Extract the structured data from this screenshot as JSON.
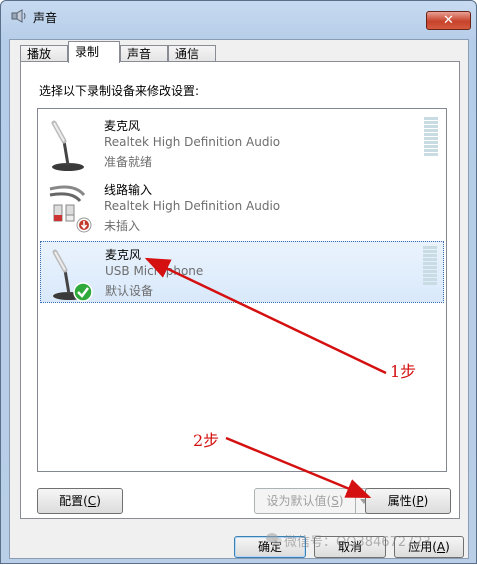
{
  "window": {
    "title": "声音",
    "close_symbol": "✕"
  },
  "tabs": [
    {
      "label": "播放",
      "active": false
    },
    {
      "label": "录制",
      "active": true
    },
    {
      "label": "声音",
      "active": false
    },
    {
      "label": "通信",
      "active": false
    }
  ],
  "instructions": "选择以下录制设备来修改设置:",
  "devices": [
    {
      "name": "麦克风",
      "driver": "Realtek High Definition Audio",
      "status": "准备就绪",
      "icon": "microphone-icon",
      "selected": false
    },
    {
      "name": "线路输入",
      "driver": "Realtek High Definition Audio",
      "status": "未插入",
      "icon": "line-in-cable-icon",
      "badge": "unplugged-icon",
      "selected": false
    },
    {
      "name": "麦克风",
      "driver": "USB Microphone",
      "status": "默认设备",
      "icon": "microphone-icon",
      "badge": "default-check-icon",
      "selected": true
    }
  ],
  "buttons": {
    "configure": "配置(",
    "configure_key": "C",
    "configure_end": ")",
    "set_default": "设为默认值(",
    "set_default_key": "S",
    "set_default_end": ")",
    "properties": "属性(",
    "properties_key": "P",
    "properties_end": ")",
    "ok": "确定",
    "cancel": "取消",
    "apply": "应用(",
    "apply_key": "A",
    "apply_end": ")"
  },
  "annotations": {
    "step1": "1步",
    "step2": "2步",
    "arrow_color": "#d41010"
  },
  "watermark": "微信号：QQ384672723",
  "colors": {
    "title_bar": "#b9cfe8",
    "selection": "#d9e9fb",
    "close_button": "#c7432b",
    "default_check": "#2faa3a"
  }
}
